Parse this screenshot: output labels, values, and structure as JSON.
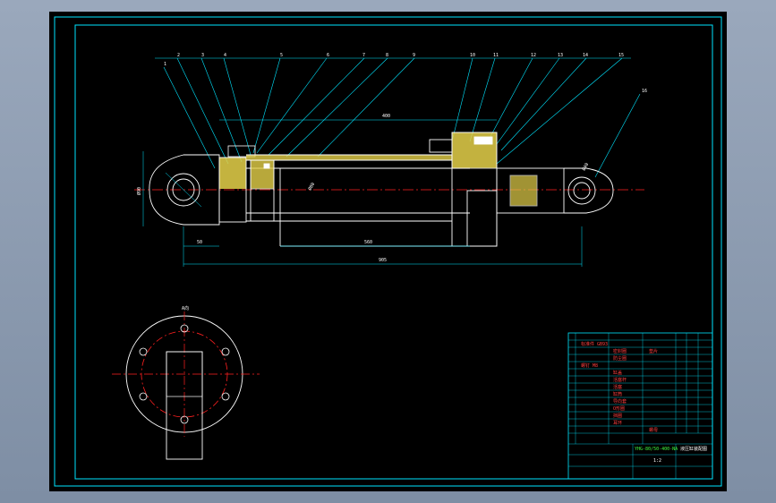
{
  "colors": {
    "background": "#000000",
    "frame": "#00e5ff",
    "outline": "#ffffff",
    "center_line": "#ff2020",
    "hatch": "#e6d24a",
    "dimension": "#00e5ff",
    "text": "#ffffff"
  },
  "drawing": {
    "part_labels": [
      "1",
      "2",
      "3",
      "4",
      "5",
      "6",
      "7",
      "8",
      "9",
      "10",
      "11",
      "12",
      "13",
      "14",
      "15",
      "16"
    ],
    "dimensions": {
      "stroke": "400",
      "eye_width": "50",
      "head_height": "Ø90",
      "bore": "Ø80",
      "rod_length": "560",
      "total_length": "905",
      "eye_hole": "Ø40"
    },
    "end_view_label": "A向"
  },
  "title_block": {
    "drawing_number": "YHG-80/50-400-NA",
    "title": "液压缸装配图",
    "scale": "1:2",
    "rows": [
      "标准件 GB93",
      "密封圈",
      "防尘圈",
      "螺钉 M8",
      "缸盖",
      "活塞杆",
      "活塞",
      "缸筒",
      "导向套",
      "O形圈",
      "挡圈",
      "耳环",
      "螺母",
      "垫片"
    ]
  }
}
